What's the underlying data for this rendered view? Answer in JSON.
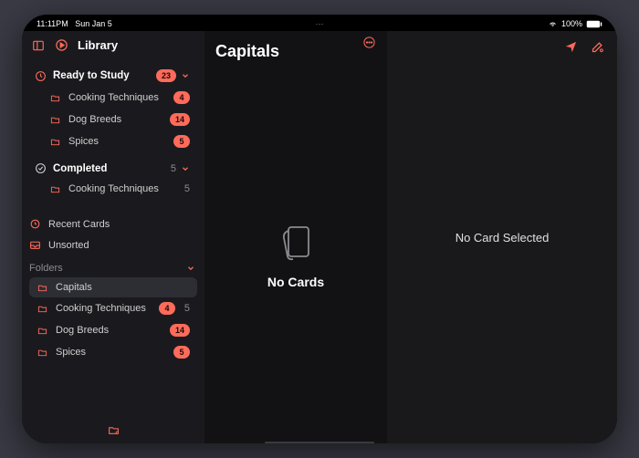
{
  "status": {
    "time": "11:11PM",
    "date": "Sun Jan 5",
    "wifi": "100%"
  },
  "sidebar": {
    "title": "Library",
    "ready": {
      "label": "Ready to Study",
      "badge": "23",
      "items": [
        {
          "label": "Cooking Techniques",
          "badge": "4"
        },
        {
          "label": "Dog Breeds",
          "badge": "14"
        },
        {
          "label": "Spices",
          "badge": "5"
        }
      ]
    },
    "completed": {
      "label": "Completed",
      "count": "5",
      "items": [
        {
          "label": "Cooking Techniques",
          "count": "5"
        }
      ]
    },
    "recent_label": "Recent Cards",
    "unsorted_label": "Unsorted",
    "folders_label": "Folders",
    "folders": [
      {
        "label": "Capitals",
        "badge": "",
        "count": "",
        "selected": true
      },
      {
        "label": "Cooking Techniques",
        "badge": "4",
        "count": "5"
      },
      {
        "label": "Dog Breeds",
        "badge": "14",
        "count": ""
      },
      {
        "label": "Spices",
        "badge": "5",
        "count": ""
      }
    ]
  },
  "middle": {
    "title": "Capitals",
    "empty_label": "No Cards"
  },
  "detail": {
    "empty_label": "No Card Selected"
  }
}
